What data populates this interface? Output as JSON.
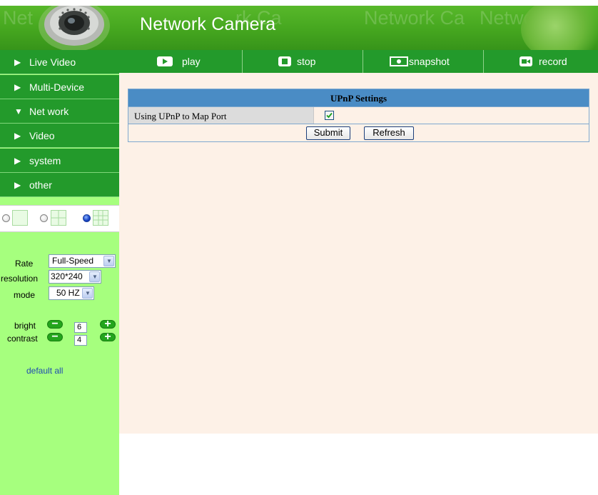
{
  "header": {
    "title": "Network Camera",
    "watermark": "Network Camera"
  },
  "sidebar": {
    "items": [
      {
        "label": "Live Video",
        "arrow": "▶"
      },
      {
        "label": "Multi-Device",
        "arrow": "▶"
      },
      {
        "label": "Net work",
        "arrow": "▼"
      },
      {
        "label": "Video",
        "arrow": "▶"
      },
      {
        "label": "system",
        "arrow": "▶"
      },
      {
        "label": "other",
        "arrow": "▶"
      }
    ],
    "controls": {
      "rate_label": "Rate",
      "rate_value": "Full-Speed",
      "resolution_label": "resolution",
      "resolution_value": "320*240",
      "mode_label": "mode",
      "mode_value": "50 HZ",
      "bright_label": "bright",
      "bright_value": "6",
      "contrast_label": "contrast",
      "contrast_value": "4",
      "minus": "−",
      "plus": "+"
    },
    "default_all": "default all"
  },
  "toolbar": {
    "play": "play",
    "stop": "stop",
    "snapshot": "snapshot",
    "record": "record"
  },
  "upnp": {
    "title": "UPnP Settings",
    "field_label": "Using UPnP to Map Port",
    "checked": true,
    "submit": "Submit",
    "refresh": "Refresh"
  },
  "colors": {
    "nav_green": "#239a2b",
    "sidebar_bg": "#a6ff7e",
    "content_bg": "#fdf1e7",
    "table_header": "#4a8cc5"
  }
}
